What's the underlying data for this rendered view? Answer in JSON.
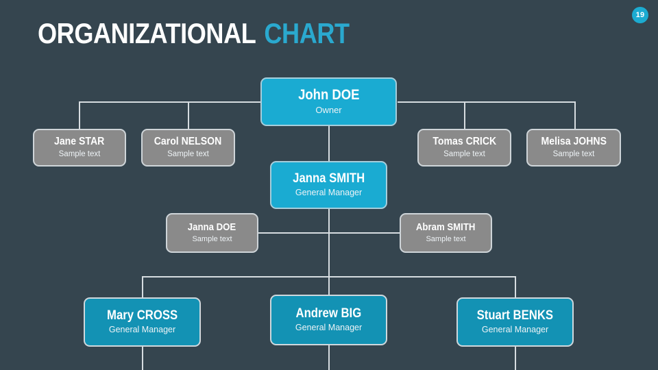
{
  "slide": {
    "page_number": "19",
    "background_color": "#35454f",
    "accent_color": "#1aabd2",
    "gray_color": "#8a8a8a",
    "line_color": "#d7dde1"
  },
  "title": {
    "main": "ORGANIZATIONAL",
    "accent": "CHART"
  },
  "chart_data": {
    "type": "diagram",
    "diagram_type": "organizational-chart",
    "title": "ORGANIZATIONAL CHART",
    "nodes": [
      {
        "id": "john-doe",
        "name": "John DOE",
        "role": "Owner",
        "style": "accent"
      },
      {
        "id": "jane-star",
        "name": "Jane STAR",
        "role": "Sample text",
        "style": "gray"
      },
      {
        "id": "carol-nelson",
        "name": "Carol NELSON",
        "role": "Sample text",
        "style": "gray"
      },
      {
        "id": "tomas-crick",
        "name": "Tomas CRICK",
        "role": "Sample text",
        "style": "gray"
      },
      {
        "id": "melisa-johns",
        "name": "Melisa JOHNS",
        "role": "Sample text",
        "style": "gray"
      },
      {
        "id": "janna-smith",
        "name": "Janna SMITH",
        "role": "General Manager",
        "style": "accent"
      },
      {
        "id": "janna-doe",
        "name": "Janna DOE",
        "role": "Sample text",
        "style": "gray"
      },
      {
        "id": "abram-smith",
        "name": "Abram SMITH",
        "role": "Sample text",
        "style": "gray"
      },
      {
        "id": "mary-cross",
        "name": "Mary CROSS",
        "role": "General Manager",
        "style": "accent-dark"
      },
      {
        "id": "andrew-big",
        "name": "Andrew BIG",
        "role": "General Manager",
        "style": "accent-dark"
      },
      {
        "id": "stuart-benks",
        "name": "Stuart BENKS",
        "role": "General Manager",
        "style": "accent-dark"
      }
    ],
    "edges": [
      {
        "from": "john-doe",
        "to": "jane-star"
      },
      {
        "from": "john-doe",
        "to": "carol-nelson"
      },
      {
        "from": "john-doe",
        "to": "tomas-crick"
      },
      {
        "from": "john-doe",
        "to": "melisa-johns"
      },
      {
        "from": "john-doe",
        "to": "janna-smith"
      },
      {
        "from": "janna-smith",
        "to": "janna-doe"
      },
      {
        "from": "janna-smith",
        "to": "abram-smith"
      },
      {
        "from": "janna-smith",
        "to": "mary-cross"
      },
      {
        "from": "janna-smith",
        "to": "andrew-big"
      },
      {
        "from": "janna-smith",
        "to": "stuart-benks"
      }
    ]
  }
}
